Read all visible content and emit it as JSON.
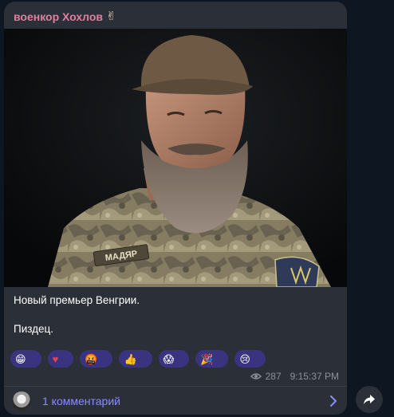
{
  "message": {
    "sender_name": "военкор Хохлов",
    "sender_emoji": "✌",
    "photo_patch_text": "МАДЯР",
    "text_lines": [
      "Новый премьер Венгрии.",
      "Пиздец."
    ],
    "reactions": [
      {
        "emoji": "😁",
        "icon": "grin-emoji-icon",
        "count": ""
      },
      {
        "emoji": "♥",
        "icon": "heart-emoji-icon",
        "count": ""
      },
      {
        "emoji": "🤬",
        "icon": "cursing-emoji-icon",
        "count": ""
      },
      {
        "emoji": "👍",
        "icon": "thumbs-up-emoji-icon",
        "count": ""
      },
      {
        "emoji": "😱",
        "icon": "screaming-emoji-icon",
        "count": ""
      },
      {
        "emoji": "🎉",
        "icon": "party-popper-emoji-icon",
        "count": ""
      },
      {
        "emoji": "😢",
        "icon": "crying-emoji-icon",
        "count": ""
      }
    ],
    "views": "287",
    "time": "9:15:37 PM",
    "comments_label": "1 комментарий"
  },
  "colors": {
    "background": "#0e1621",
    "bubble": "#2b2f38",
    "sender": "#e07fa0",
    "reaction_chip": "#3a3480",
    "link": "#8a8cff",
    "meta": "#8b929c"
  },
  "icons": {
    "views": "eye-icon",
    "comments_arrow": "chevron-right-icon",
    "share": "share-arrow-icon"
  }
}
